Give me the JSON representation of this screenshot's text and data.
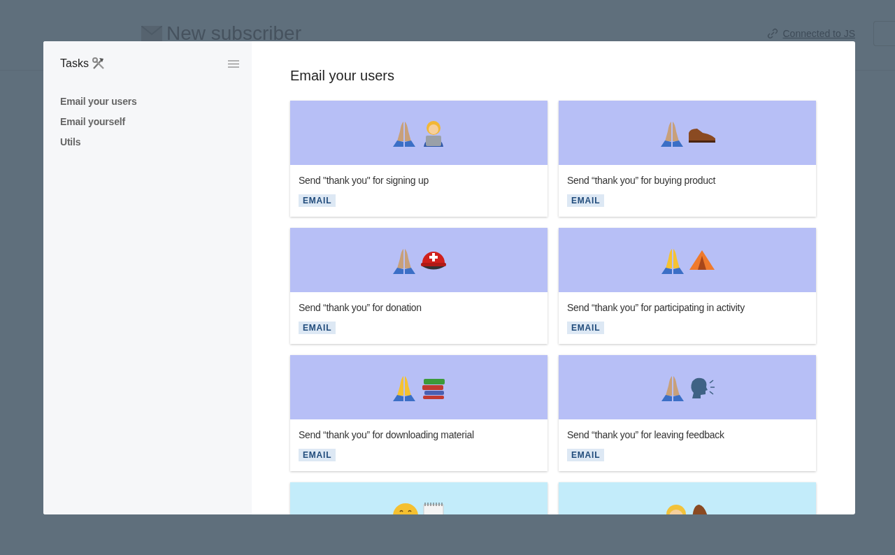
{
  "page": {
    "title": "New subscriber",
    "connection_link": "Connected to JS"
  },
  "sidebar": {
    "title": "Tasks",
    "items": [
      {
        "label": "Email your users"
      },
      {
        "label": "Email yourself"
      },
      {
        "label": "Utils"
      }
    ]
  },
  "main": {
    "heading": "Email your users",
    "cards": [
      {
        "title": "Send \"thank you\" for signing up",
        "tag": "EMAIL",
        "color": "#b7bff6"
      },
      {
        "title": "Send “thank you” for buying product",
        "tag": "EMAIL",
        "color": "#b7bff6"
      },
      {
        "title": "Send “thank you” for donation",
        "tag": "EMAIL",
        "color": "#b7bff6"
      },
      {
        "title": "Send “thank you” for participating in activity",
        "tag": "EMAIL",
        "color": "#b7bff6"
      },
      {
        "title": "Send “thank you” for downloading material",
        "tag": "EMAIL",
        "color": "#b7bff6"
      },
      {
        "title": "Send “thank you” for leaving feedback",
        "tag": "EMAIL",
        "color": "#b7bff6"
      },
      {
        "color": "#c3ecfa"
      },
      {
        "color": "#c3ecfa"
      }
    ]
  }
}
